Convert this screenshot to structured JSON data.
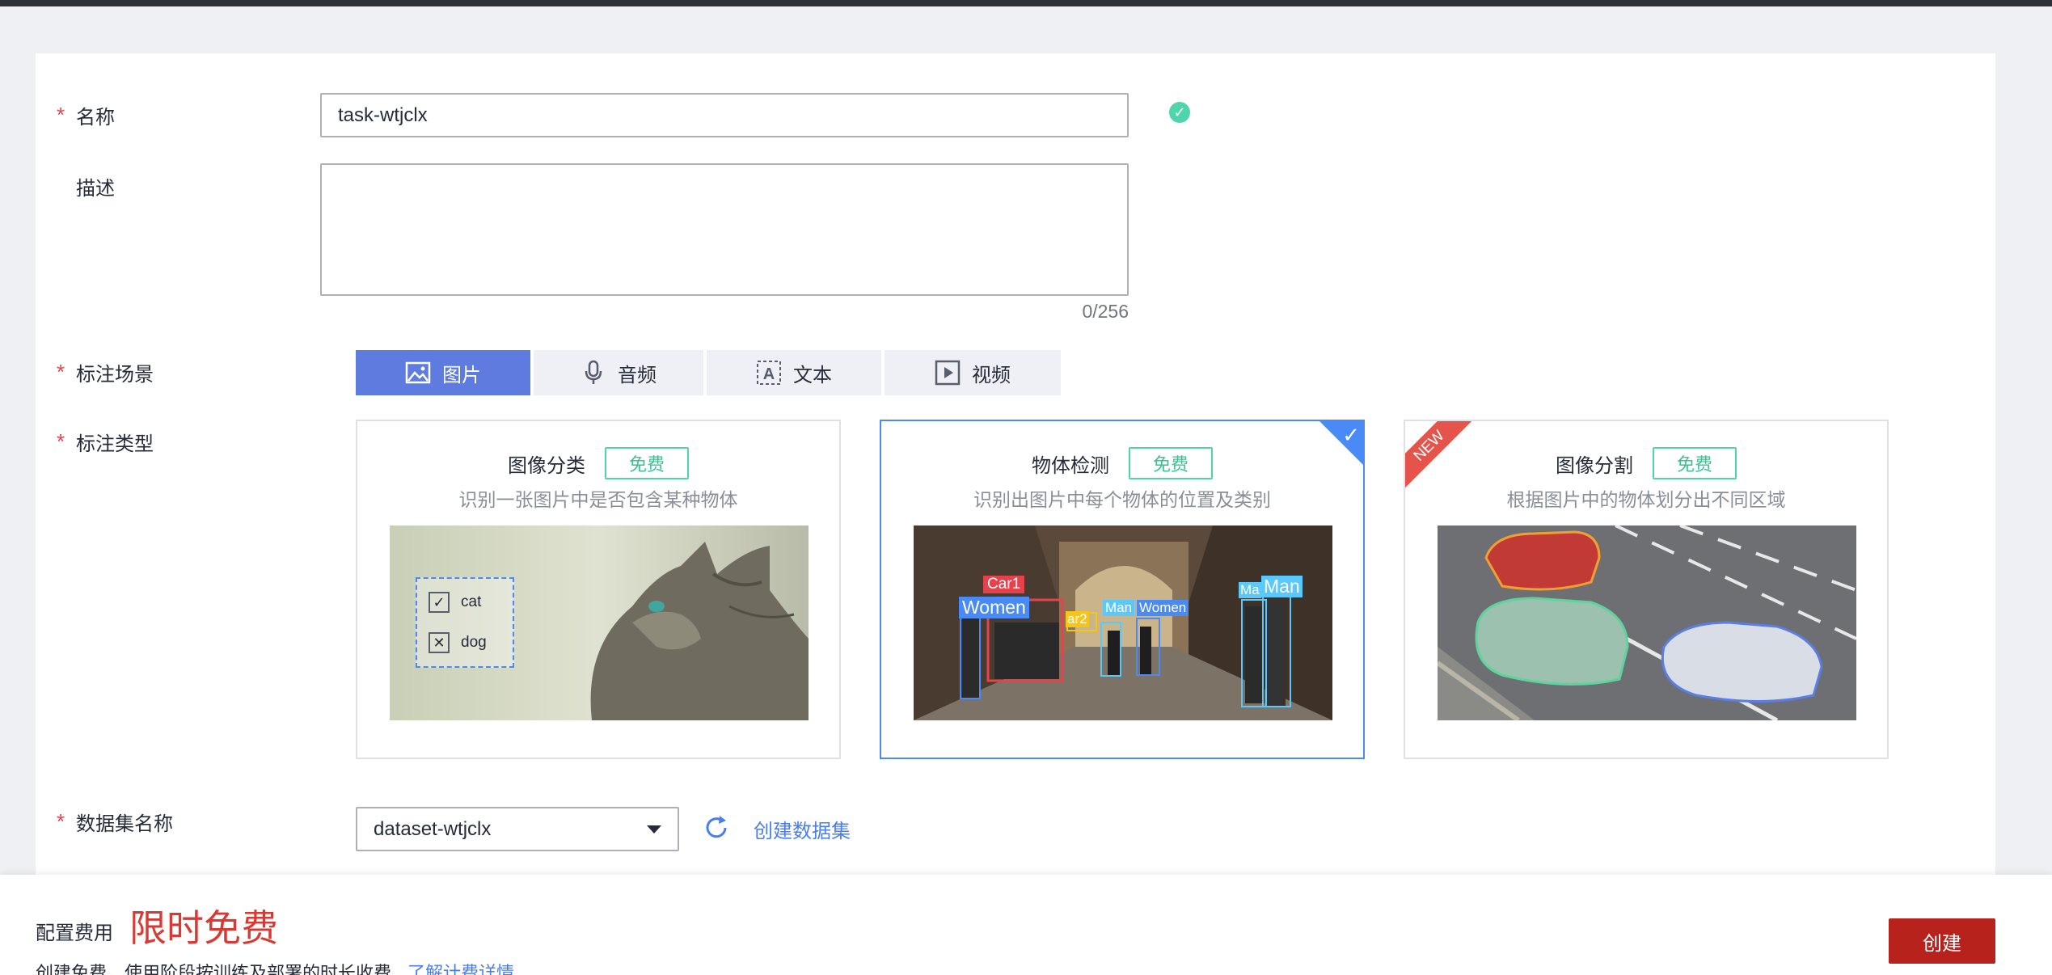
{
  "form": {
    "name": {
      "label": "名称",
      "required": true,
      "value": "task-wtjclx"
    },
    "description": {
      "label": "描述",
      "required": false,
      "value": "",
      "counter": "0/256"
    },
    "scene": {
      "label": "标注场景",
      "required": true,
      "options": [
        {
          "label": "图片",
          "icon": "image-icon",
          "active": true
        },
        {
          "label": "音频",
          "icon": "microphone-icon",
          "active": false
        },
        {
          "label": "文本",
          "icon": "text-icon",
          "active": false
        },
        {
          "label": "视频",
          "icon": "video-icon",
          "active": false
        }
      ]
    },
    "type": {
      "label": "标注类型",
      "required": true,
      "cards": [
        {
          "title": "图像分类",
          "badge": "免费",
          "desc": "识别一张图片中是否包含某种物体",
          "selected": false,
          "corner": "",
          "checks": [
            "cat",
            "dog"
          ]
        },
        {
          "title": "物体检测",
          "badge": "免费",
          "desc": "识别出图片中每个物体的位置及类别",
          "selected": true,
          "corner": "check",
          "tags": [
            "Car1",
            "Women",
            "ar2",
            "Man",
            "Women",
            "Ma",
            "Man"
          ]
        },
        {
          "title": "图像分割",
          "badge": "免费",
          "desc": "根据图片中的物体划分出不同区域",
          "selected": false,
          "corner": "NEW"
        }
      ]
    },
    "dataset": {
      "label": "数据集名称",
      "required": true,
      "value": "dataset-wtjclx",
      "create_link": "创建数据集"
    }
  },
  "footer": {
    "fee_label": "配置费用",
    "fee_value": "限时免费",
    "note": "创建免费，使用阶段按训练及部署的时长收费",
    "note_link": "了解计费详情",
    "create_button": "创建"
  },
  "colors": {
    "primary": "#5e7ce0",
    "selected_border": "#4a8af4",
    "badge_green": "#50d4ab",
    "danger": "#b8221c",
    "link": "#4a7ef0"
  }
}
